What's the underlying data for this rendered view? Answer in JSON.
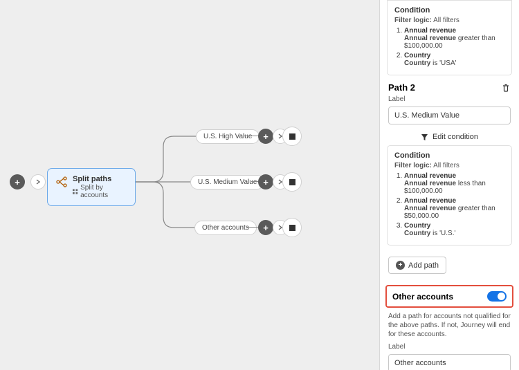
{
  "canvas": {
    "split_node": {
      "title": "Split paths",
      "subtitle": "Split by accounts"
    },
    "paths": [
      {
        "label": "U.S. High Value"
      },
      {
        "label": "U.S. Medium Value"
      },
      {
        "label": "Other accounts"
      }
    ]
  },
  "sidebar": {
    "cond1": {
      "title": "Condition",
      "filter_logic_label": "Filter logic:",
      "filter_logic_value": "All filters",
      "items": [
        {
          "field": "Annual revenue",
          "detail_field": "Annual revenue",
          "detail_op": "greater than",
          "detail_val": "$100,000.00"
        },
        {
          "field": "Country",
          "detail_field": "Country",
          "detail_op": "is",
          "detail_val": "'USA'"
        }
      ]
    },
    "path2": {
      "header": "Path 2",
      "label_field": "Label",
      "label_value": "U.S. Medium Value",
      "edit_condition": "Edit condition"
    },
    "cond2": {
      "title": "Condition",
      "filter_logic_label": "Filter logic:",
      "filter_logic_value": "All filters",
      "items": [
        {
          "field": "Annual revenue",
          "detail_field": "Annual revenue",
          "detail_op": "less than",
          "detail_val": "$100,000.00"
        },
        {
          "field": "Annual revenue",
          "detail_field": "Annual revenue",
          "detail_op": "greater than",
          "detail_val": "$50,000.00"
        },
        {
          "field": "Country",
          "detail_field": "Country",
          "detail_op": "is",
          "detail_val": "'U.S.'"
        }
      ]
    },
    "add_path_label": "Add path",
    "other": {
      "title": "Other accounts",
      "toggle": true,
      "description": "Add a path for accounts not qualified for the above paths. If not, Journey will end for these accounts.",
      "label_field": "Label",
      "label_value": "Other accounts"
    }
  }
}
